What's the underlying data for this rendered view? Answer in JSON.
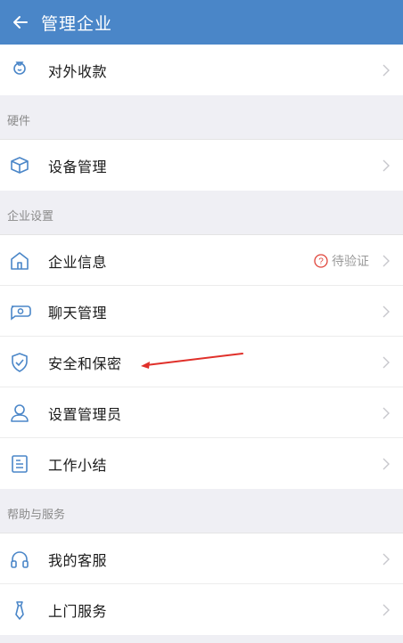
{
  "header": {
    "title": "管理企业"
  },
  "sections": [
    {
      "title": "",
      "items": [
        {
          "label": "对外收款",
          "icon": "money-bag-icon"
        }
      ]
    },
    {
      "title": "硬件",
      "items": [
        {
          "label": "设备管理",
          "icon": "device-box-icon"
        }
      ]
    },
    {
      "title": "企业设置",
      "items": [
        {
          "label": "企业信息",
          "icon": "home-icon",
          "status": "待验证"
        },
        {
          "label": "聊天管理",
          "icon": "chat-icon"
        },
        {
          "label": "安全和保密",
          "icon": "shield-icon"
        },
        {
          "label": "设置管理员",
          "icon": "admin-user-icon"
        },
        {
          "label": "工作小结",
          "icon": "work-summary-icon"
        }
      ]
    },
    {
      "title": "帮助与服务",
      "items": [
        {
          "label": "我的客服",
          "icon": "headset-icon"
        },
        {
          "label": "上门服务",
          "icon": "tie-icon"
        }
      ]
    }
  ],
  "colors": {
    "header_bg": "#4a86c8",
    "icon_stroke": "#4a86c8",
    "status_red": "#e0443a",
    "annotation_red": "#e0302a"
  }
}
